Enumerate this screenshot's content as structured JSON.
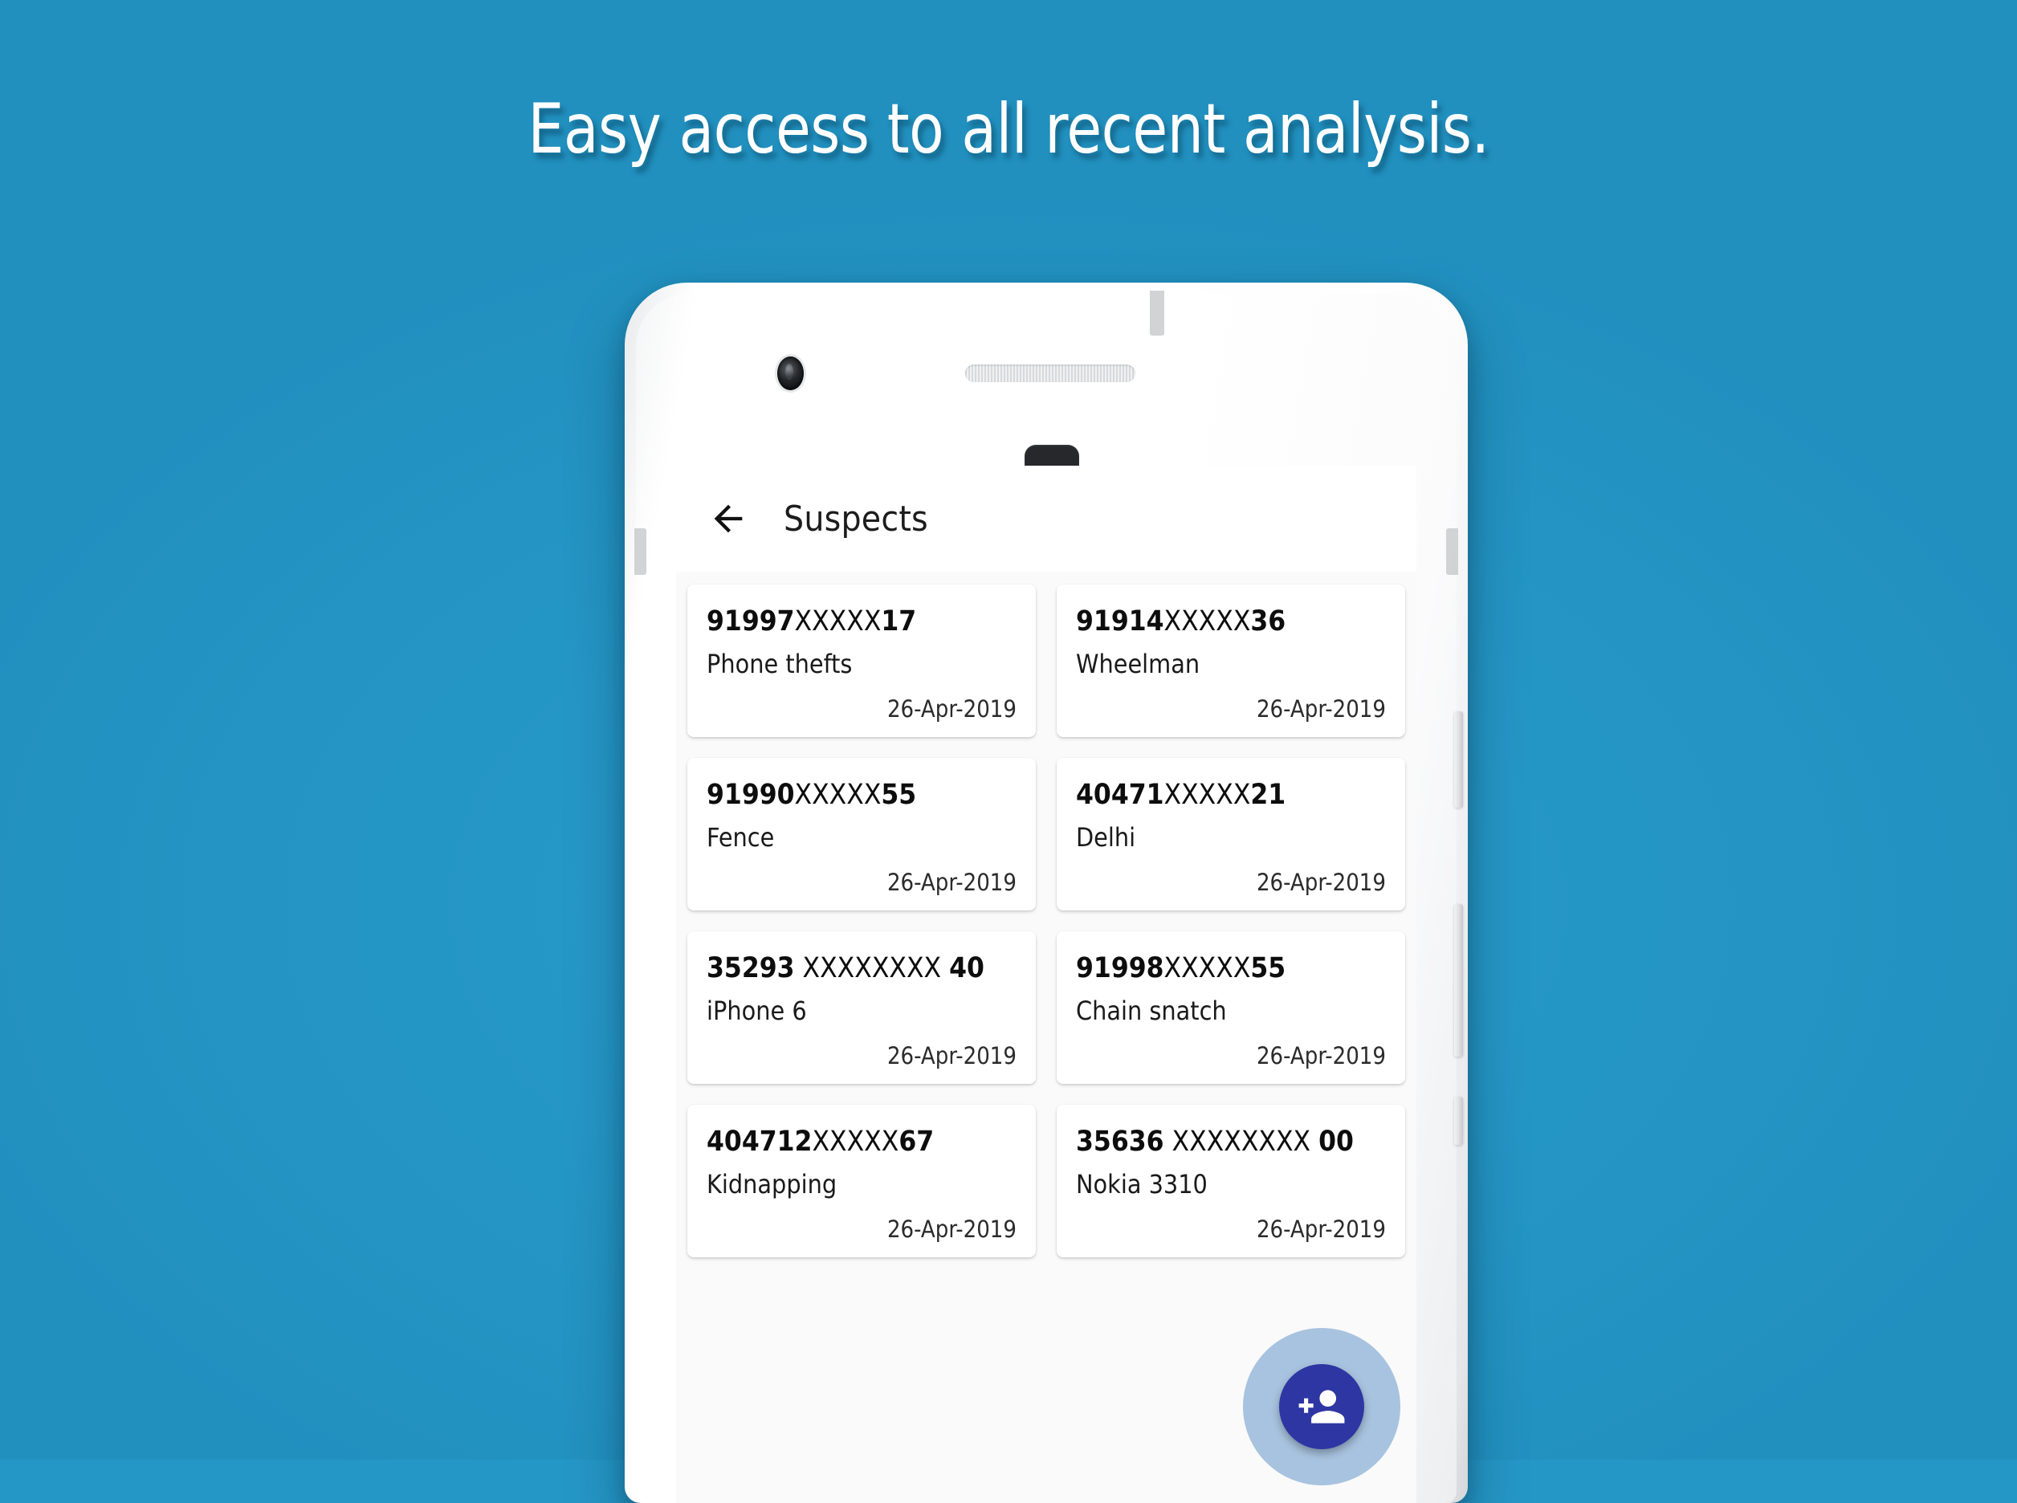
{
  "marketing": {
    "headline": "Easy access to all recent analysis.",
    "background_color": "#2597c7"
  },
  "app": {
    "appbar": {
      "back_icon": "arrow-left-icon",
      "title": "Suspects"
    },
    "fab": {
      "icon": "person-add-icon",
      "color": "#2e36a3",
      "ripple_color": "#93b7d6"
    },
    "cards": [
      {
        "prefix": "91997",
        "mask": "XXXXX",
        "suffix": "17",
        "label": "Phone thefts",
        "date": "26-Apr-2019"
      },
      {
        "prefix": "91914",
        "mask": "XXXXX",
        "suffix": "36",
        "label": "Wheelman",
        "date": "26-Apr-2019"
      },
      {
        "prefix": "91990",
        "mask": "XXXXX",
        "suffix": "55",
        "label": "Fence",
        "date": "26-Apr-2019"
      },
      {
        "prefix": "40471",
        "mask": "XXXXX",
        "suffix": "21",
        "label": "Delhi",
        "date": "26-Apr-2019"
      },
      {
        "prefix": "35293",
        "mask": " XXXXXXXX ",
        "suffix": "40",
        "label": "iPhone 6",
        "date": "26-Apr-2019"
      },
      {
        "prefix": "91998",
        "mask": "XXXXX",
        "suffix": "55",
        "label": "Chain snatch",
        "date": "26-Apr-2019"
      },
      {
        "prefix": "404712",
        "mask": "XXXXX",
        "suffix": "67",
        "label": "Kidnapping",
        "date": "26-Apr-2019"
      },
      {
        "prefix": "35636",
        "mask": " XXXXXXXX ",
        "suffix": "00",
        "label": "Nokia 3310",
        "date": "26-Apr-2019"
      }
    ]
  }
}
